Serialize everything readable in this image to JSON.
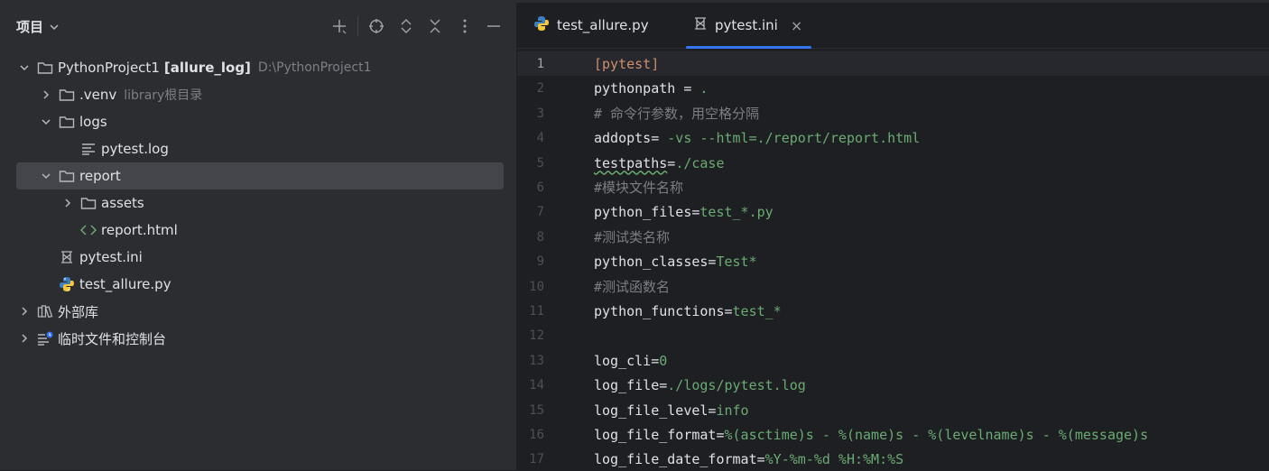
{
  "project_pane": {
    "title": "项目",
    "tree": [
      {
        "label": "PythonProject1",
        "bold": "[allure_log]",
        "muted": "D:\\PythonProject1",
        "icon": "folder-icon",
        "expanded": true,
        "depth": 0
      },
      {
        "label": ".venv",
        "muted": "library根目录",
        "icon": "folder-icon",
        "expanded": false,
        "depth": 1
      },
      {
        "label": "logs",
        "icon": "folder-icon",
        "expanded": true,
        "depth": 1
      },
      {
        "label": "pytest.log",
        "icon": "text-file-icon",
        "depth": 2
      },
      {
        "label": "report",
        "icon": "folder-icon",
        "expanded": true,
        "depth": 1,
        "selected": true
      },
      {
        "label": "assets",
        "icon": "folder-icon",
        "expanded": false,
        "depth": 2
      },
      {
        "label": "report.html",
        "icon": "html-file-icon",
        "depth": 2
      },
      {
        "label": "pytest.ini",
        "icon": "ini-file-icon",
        "depth": 1
      },
      {
        "label": "test_allure.py",
        "icon": "python-file-icon",
        "depth": 1
      },
      {
        "label": "外部库",
        "icon": "library-icon",
        "expanded": false,
        "depth": 0
      },
      {
        "label": "临时文件和控制台",
        "icon": "scratches-icon",
        "expanded": false,
        "depth": 0
      }
    ]
  },
  "editor": {
    "tabs": [
      {
        "label": "test_allure.py",
        "icon": "python-file-icon",
        "active": false
      },
      {
        "label": "pytest.ini",
        "icon": "ini-file-icon",
        "active": true
      }
    ],
    "lines": [
      {
        "n": "1",
        "parts": [
          {
            "t": "[pytest]",
            "c": "s"
          }
        ]
      },
      {
        "n": "2",
        "parts": [
          {
            "t": "pythonpath = ",
            "c": "k"
          },
          {
            "t": ".",
            "c": "v"
          }
        ]
      },
      {
        "n": "3",
        "parts": [
          {
            "t": "# 命令行参数，用空格分隔",
            "c": "c"
          }
        ]
      },
      {
        "n": "4",
        "parts": [
          {
            "t": "addopts= ",
            "c": "k"
          },
          {
            "t": "-vs --html=./report/report.html",
            "c": "v"
          }
        ]
      },
      {
        "n": "5",
        "parts": [
          {
            "t": "testpaths",
            "c": "k wavy"
          },
          {
            "t": "=",
            "c": "k"
          },
          {
            "t": "./case",
            "c": "v"
          }
        ]
      },
      {
        "n": "6",
        "parts": [
          {
            "t": "#模块文件名称",
            "c": "c"
          }
        ]
      },
      {
        "n": "7",
        "parts": [
          {
            "t": "python_files=",
            "c": "k"
          },
          {
            "t": "test_*.py",
            "c": "v"
          }
        ]
      },
      {
        "n": "8",
        "parts": [
          {
            "t": "#测试类名称",
            "c": "c"
          }
        ]
      },
      {
        "n": "9",
        "parts": [
          {
            "t": "python_classes=",
            "c": "k"
          },
          {
            "t": "Test*",
            "c": "v"
          }
        ]
      },
      {
        "n": "10",
        "parts": [
          {
            "t": "#测试函数名",
            "c": "c"
          }
        ]
      },
      {
        "n": "11",
        "parts": [
          {
            "t": "python_functions=",
            "c": "k"
          },
          {
            "t": "test_*",
            "c": "v"
          }
        ]
      },
      {
        "n": "12",
        "parts": []
      },
      {
        "n": "13",
        "parts": [
          {
            "t": "log_cli=",
            "c": "k"
          },
          {
            "t": "0",
            "c": "v"
          }
        ]
      },
      {
        "n": "14",
        "parts": [
          {
            "t": "log_file=",
            "c": "k"
          },
          {
            "t": "./logs/pytest.log",
            "c": "v"
          }
        ]
      },
      {
        "n": "15",
        "parts": [
          {
            "t": "log_file_level=",
            "c": "k"
          },
          {
            "t": "info",
            "c": "v"
          }
        ]
      },
      {
        "n": "16",
        "parts": [
          {
            "t": "log_file_format=",
            "c": "k"
          },
          {
            "t": "%(asctime)s - %(name)s - %(levelname)s - %(message)s",
            "c": "v"
          }
        ]
      },
      {
        "n": "17",
        "parts": [
          {
            "t": "log_file_date_format=",
            "c": "k"
          },
          {
            "t": "%Y-%m-%d %H:%M:%S",
            "c": "v"
          }
        ]
      }
    ]
  }
}
